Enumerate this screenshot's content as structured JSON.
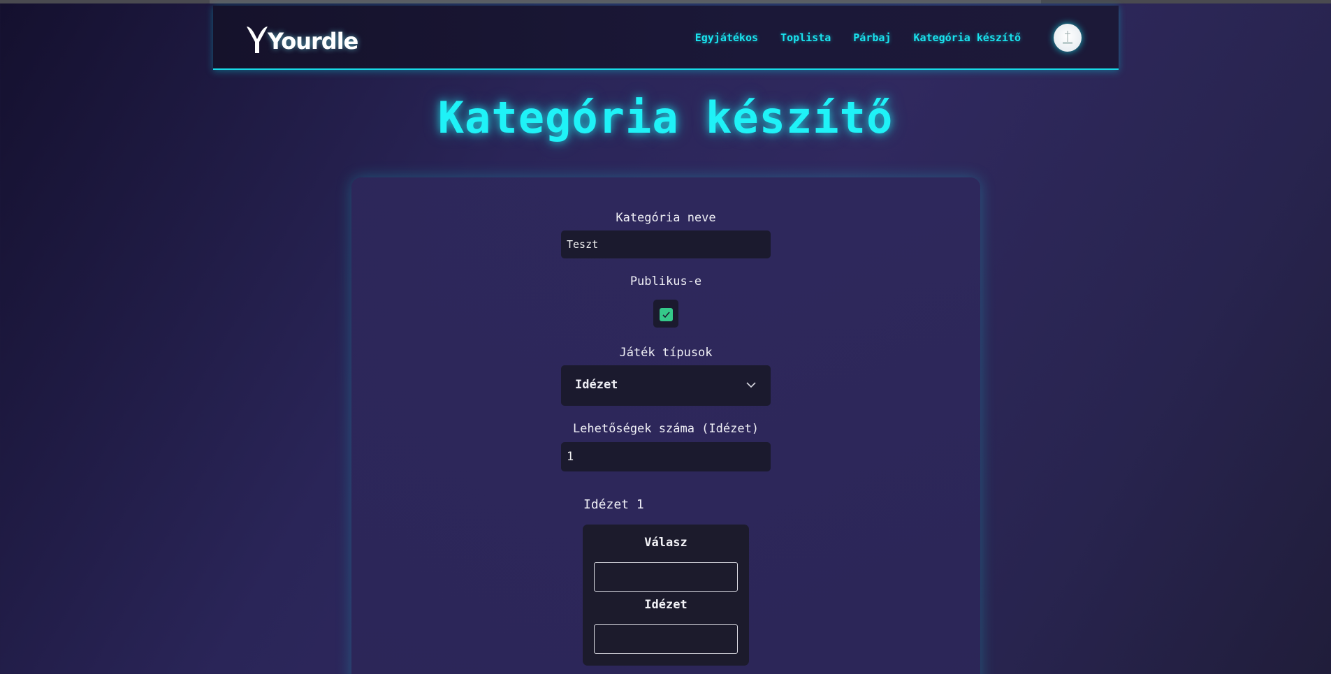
{
  "nav": {
    "logo_text": "Yourdle",
    "links": [
      "Egyjátékos",
      "Toplista",
      "Párbaj",
      "Kategória készítő"
    ]
  },
  "page": {
    "title": "Kategória készítő"
  },
  "form": {
    "name_label": "Kategória neve",
    "name_value": "Teszt",
    "public_label": "Publikus-e",
    "public_checked": true,
    "game_types_label": "Játék típusok",
    "game_type_selected": "Idézet",
    "options_count_label": "Lehetőségek száma (Idézet)",
    "options_count_value": "1"
  },
  "quote": {
    "title": "Idézet 1",
    "answer_label": "Válasz",
    "answer_value": "",
    "quote_label": "Idézet",
    "quote_value": ""
  },
  "icons": {
    "checkbox": "check-icon",
    "select": "chevron-down-icon",
    "avatar": "avatar-image"
  },
  "colors": {
    "accent": "#1ff2f7",
    "checkbox": "#35c98a",
    "input_bg": "#1b1a2e"
  }
}
